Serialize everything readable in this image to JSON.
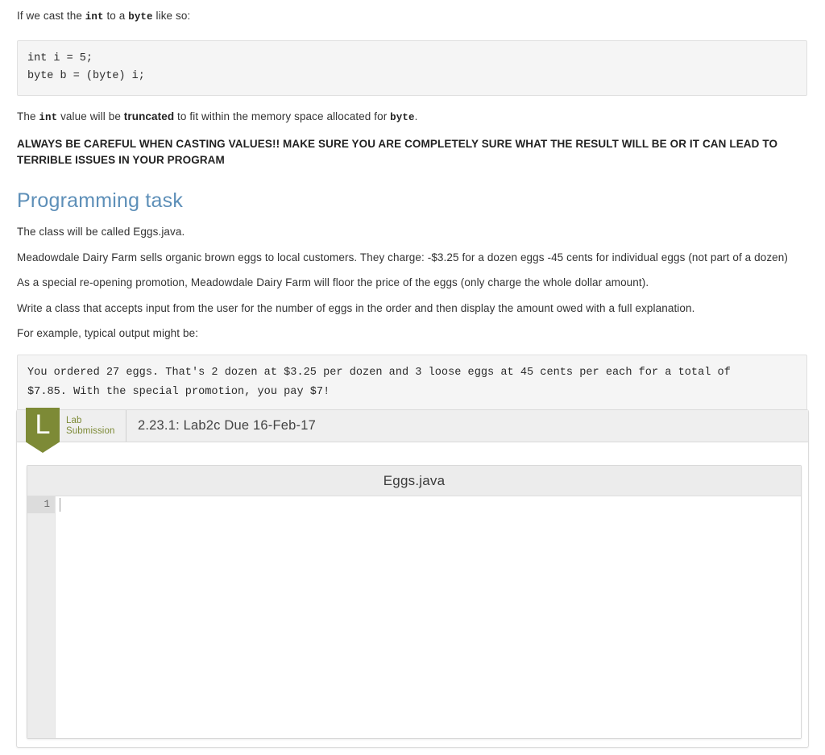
{
  "lesson": {
    "intro_prefix": "If we cast the ",
    "intro_code1": "int",
    "intro_mid": " to a ",
    "intro_code2": "byte",
    "intro_suffix": " like so:",
    "cast_example": {
      "line1": "int i = 5;",
      "line2": "byte b = (byte) i;"
    },
    "truncated_prefix": "The ",
    "truncated_code1": "int",
    "truncated_mid1": " value will be ",
    "truncated_bold": "truncated",
    "truncated_mid2": " to fit within the memory space allocated for ",
    "truncated_code2": "byte",
    "truncated_suffix": ".",
    "warning": "ALWAYS BE CAREFUL WHEN CASTING VALUES!! MAKE SURE YOU ARE COMPLETELY SURE WHAT THE RESULT WILL BE OR IT CAN LEAD TO TERRIBLE ISSUES IN YOUR PROGRAM"
  },
  "task": {
    "heading": "Programming task",
    "p1": "The class will be called Eggs.java.",
    "p2": "Meadowdale Dairy Farm sells organic brown eggs to local customers. They charge: -$3.25 for a dozen eggs -45 cents for individual eggs (not part of a dozen)",
    "p3": "As a special re-opening promotion, Meadowdale Dairy Farm will floor the price of the eggs (only charge the whole dollar amount).",
    "p4": "Write a class that accepts input from the user for the number of eggs in the order and then display the amount owed with a full explanation.",
    "p5": "For example, typical output might be:",
    "sample_output": {
      "line1": "You ordered 27 eggs. That's 2 dozen at $3.25 per dozen and 3 loose eggs at 45 cents per each for a total of",
      "line2": "$7.85. With the special promotion, you pay $7!"
    }
  },
  "lab_panel": {
    "badge_letter": "L",
    "type_line1": "Lab",
    "type_line2": "Submission",
    "title": "2.23.1: Lab2c Due 16-Feb-17",
    "editor": {
      "filename": "Eggs.java",
      "line_numbers": [
        "1"
      ],
      "lines": [
        ""
      ]
    }
  },
  "colors": {
    "accent_olive": "#7d8a36",
    "heading_blue": "#5d8fb8",
    "code_bg": "#f5f5f5",
    "panel_header_bg": "#efefef"
  }
}
